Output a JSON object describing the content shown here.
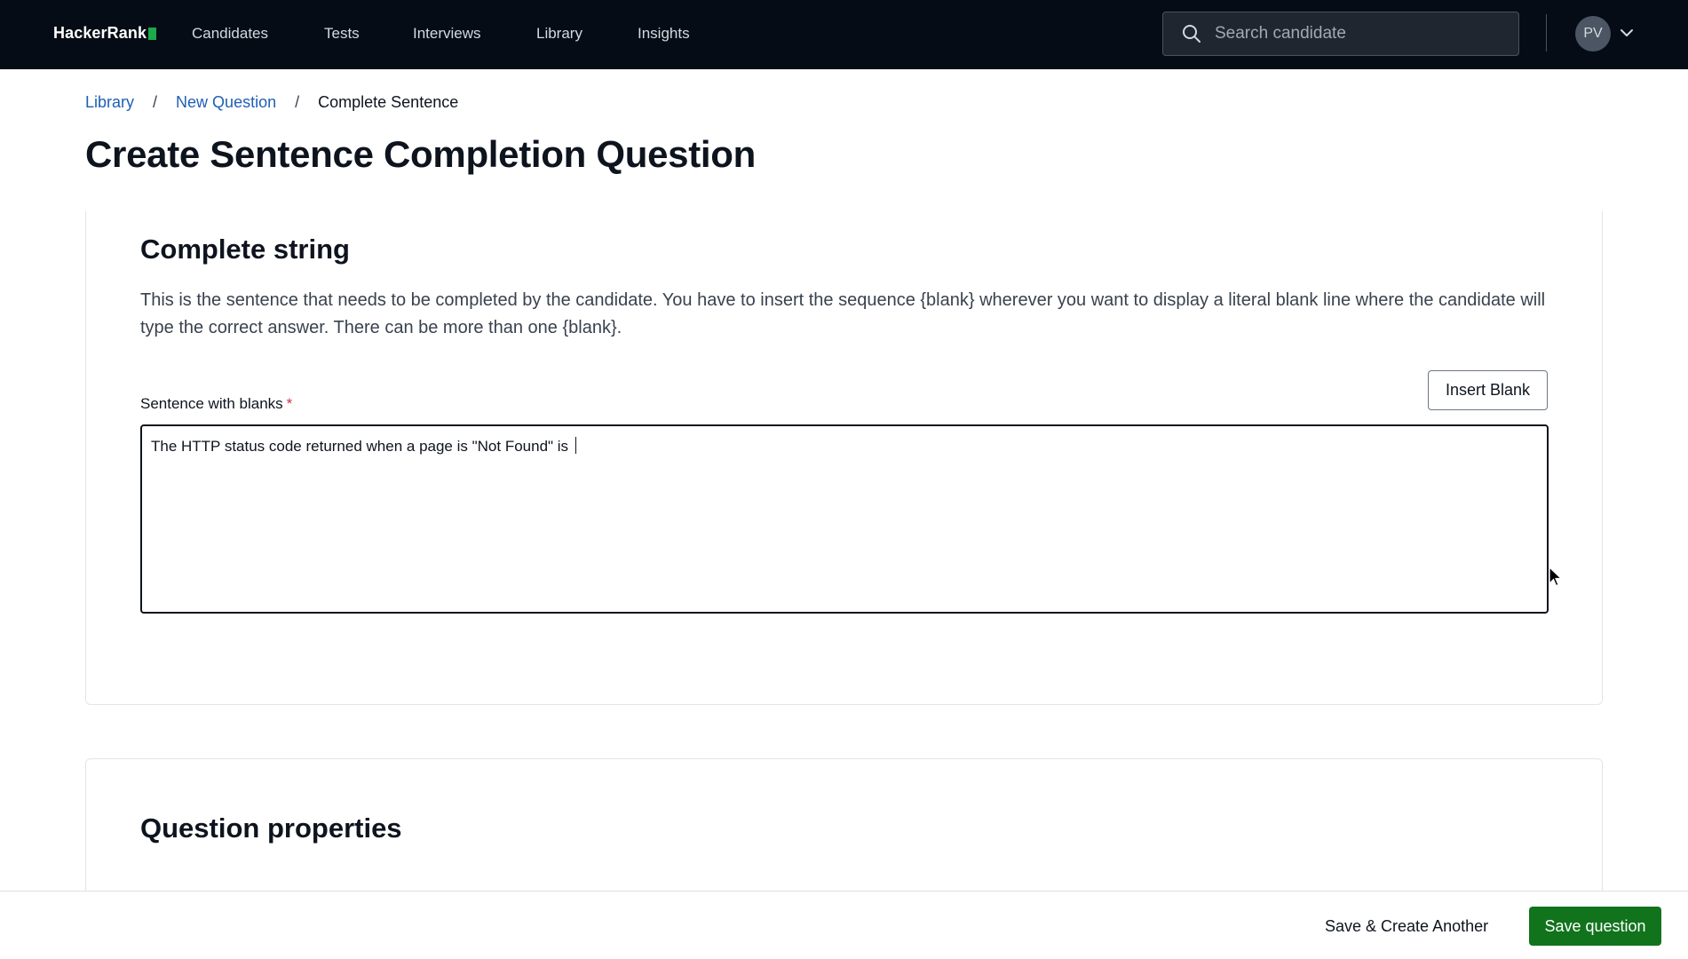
{
  "nav": {
    "logo_text": "HackerRank",
    "items": [
      {
        "label": "Candidates"
      },
      {
        "label": "Tests"
      },
      {
        "label": "Interviews"
      },
      {
        "label": "Library"
      },
      {
        "label": "Insights"
      }
    ],
    "search_placeholder": "Search candidate",
    "avatar_initials": "PV",
    "icons": {
      "search": "search-icon",
      "caret": "chevron-down-icon"
    }
  },
  "breadcrumb": {
    "items": [
      "Library",
      "New Question",
      "Complete Sentence"
    ],
    "separator": "/"
  },
  "page_title": "Create Sentence Completion Question",
  "complete_string": {
    "title": "Complete string",
    "description": "This is the sentence that needs to be completed by the candidate. You have to insert the sequence {blank} wherever you want to display a literal blank line where the candidate will type the correct answer. There can be more than one {blank}.",
    "field_label": "Sentence with blanks",
    "required_mark": "*",
    "insert_blank_label": "Insert Blank",
    "sentence_value": "The HTTP status code returned when a page is \"Not Found\" is "
  },
  "question_properties": {
    "title": "Question properties"
  },
  "footer": {
    "save_create_another_label": "Save & Create Another",
    "save_label": "Save question"
  },
  "colors": {
    "nav_bg": "#050c16",
    "link": "#1f5fb5",
    "primary": "#12731d",
    "required": "#d0334a",
    "logo_accent": "#1ba94c"
  }
}
